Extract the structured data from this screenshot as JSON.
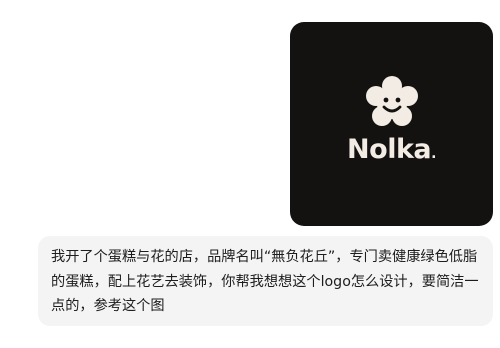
{
  "attachment": {
    "brand_text": "Nolka",
    "brand_dot": ".",
    "logo_icon": "flower-smile-icon",
    "card_color": "#141111",
    "logo_color": "#f2ece4"
  },
  "message": {
    "text": "我开了个蛋糕与花的店，品牌名叫“無负花丘”，专门卖健康绿色低脂的蛋糕，配上花艺去装饰，你帮我想想这个logo怎么设计，要简洁一点的，参考这个图",
    "bubble_color": "#f4f4f4"
  }
}
